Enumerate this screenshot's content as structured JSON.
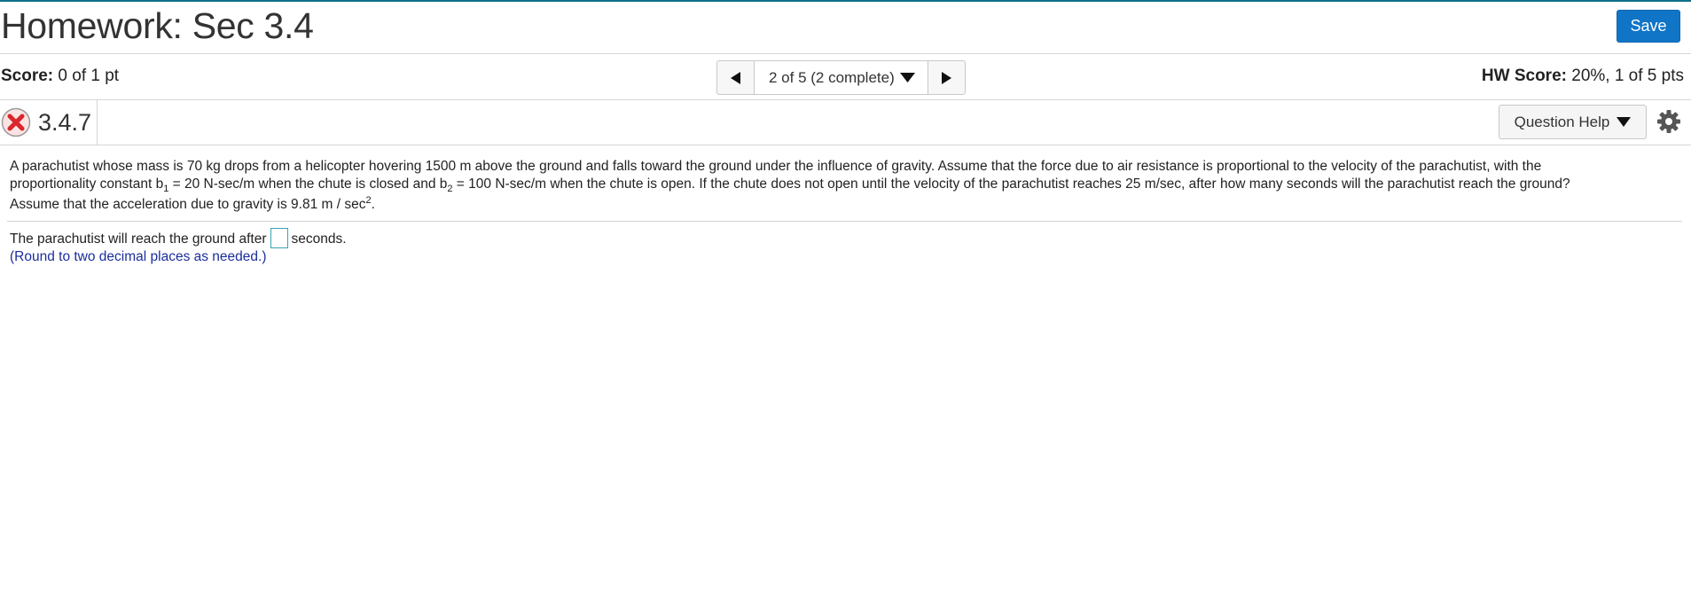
{
  "header": {
    "title": "Homework: Sec 3.4",
    "save_label": "Save"
  },
  "score_bar": {
    "score_label": "Score:",
    "score_value": "0 of 1 pt",
    "nav_label": "2 of 5 (2 complete)",
    "hw_score_label": "HW Score:",
    "hw_score_value": "20%, 1 of 5 pts"
  },
  "question_bar": {
    "number": "3.4.7",
    "status": "incorrect",
    "help_label": "Question Help"
  },
  "question": {
    "line1": "A parachutist whose mass is 70 kg drops from a helicopter hovering 1500 m above the ground and falls toward the ground under the influence of gravity. Assume that the force due to air resistance is proportional to the velocity of the parachutist, with the",
    "line2_a": "proportionality constant b",
    "sub1": "1",
    "line2_b": " = 20 N-sec/m when the chute is closed and b",
    "sub2": "2",
    "line2_c": " = 100 N-sec/m when the chute is open. If the chute does not open until the velocity of the parachutist reaches 25 m/sec, after how many seconds will the parachutist reach the ground?",
    "line3_a": "Assume that the acceleration due to gravity is 9.81 m / sec",
    "sup": "2",
    "line3_b": "."
  },
  "answer": {
    "prefix": "The parachutist will reach the ground after",
    "value": "",
    "suffix": "seconds.",
    "hint": "(Round to two decimal places as needed.)"
  },
  "colors": {
    "accent": "#1075c7",
    "incorrect": "#d9262b",
    "hint": "#1b2e9c"
  }
}
